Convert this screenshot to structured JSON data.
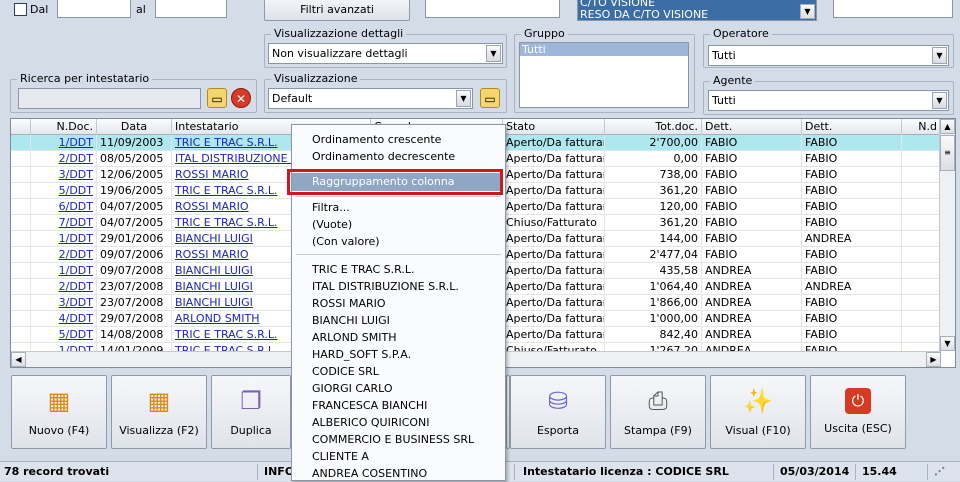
{
  "filters": {
    "dal_label": "Dal",
    "al_label": "al",
    "filtri_avanzati": "Filtri avanzati",
    "tipo_items": [
      "C/TO VISIONE",
      "RESO DA C/TO VISIONE"
    ],
    "ricerca_label": "Ricerca per intestatario",
    "ricerca_value": "",
    "dettagli_label": "Visualizzazione dettagli",
    "dettagli_value": "Non visualizzare dettagli",
    "visualizzazione_label": "Visualizzazione",
    "visualizzazione_value": "Default",
    "gruppo_label": "Gruppo",
    "gruppo_items": [
      "Tutti"
    ],
    "operatore_label": "Operatore",
    "operatore_value": "Tutti",
    "agente_label": "Agente",
    "agente_value": "Tutti"
  },
  "grid": {
    "columns": [
      "N.Doc.",
      "Data",
      "Intestatario",
      "Causale",
      "Stato",
      "Tot.doc.",
      "Dett.",
      "Dett.",
      "N.d"
    ],
    "rows": [
      {
        "ndoc": "1/DDT",
        "data": "11/09/2003",
        "intestatario": "TRIC E TRAC S.R.L.",
        "stato": "Aperto/Da fatturare",
        "tot": "2'700,00",
        "dett1": "FABIO",
        "dett2": "FABIO"
      },
      {
        "ndoc": "2/DDT",
        "data": "08/05/2005",
        "intestatario": "ITAL DISTRIBUZIONE S.R",
        "stato": "Aperto/Da fatturare",
        "tot": "0,00",
        "dett1": "FABIO",
        "dett2": "FABIO"
      },
      {
        "ndoc": "3/DDT",
        "data": "12/06/2005",
        "intestatario": "ROSSI MARIO",
        "stato": "Aperto/Da fatturare",
        "tot": "738,00",
        "dett1": "FABIO",
        "dett2": "FABIO"
      },
      {
        "ndoc": "5/DDT",
        "data": "19/06/2005",
        "intestatario": "TRIC E TRAC S.R.L.",
        "stato": "Aperto/Da fatturare",
        "tot": "361,20",
        "dett1": "FABIO",
        "dett2": "FABIO"
      },
      {
        "ndoc": "6/DDT",
        "data": "04/07/2005",
        "intestatario": "ROSSI MARIO",
        "stato": "Aperto/Da fatturare",
        "tot": "120,00",
        "dett1": "FABIO",
        "dett2": "FABIO"
      },
      {
        "ndoc": "7/DDT",
        "data": "04/07/2005",
        "intestatario": "TRIC E TRAC S.R.L.",
        "stato": "Chiuso/Fatturato",
        "tot": "361,20",
        "dett1": "FABIO",
        "dett2": "FABIO"
      },
      {
        "ndoc": "1/DDT",
        "data": "29/01/2006",
        "intestatario": "BIANCHI LUIGI",
        "stato": "Aperto/Da fatturare",
        "tot": "144,00",
        "dett1": "FABIO",
        "dett2": "ANDREA"
      },
      {
        "ndoc": "2/DDT",
        "data": "09/07/2006",
        "intestatario": "ROSSI MARIO",
        "stato": "Aperto/Da fatturare",
        "tot": "2'477,04",
        "dett1": "FABIO",
        "dett2": "FABIO"
      },
      {
        "ndoc": "1/DDT",
        "data": "09/07/2008",
        "intestatario": "BIANCHI LUIGI",
        "stato": "Aperto/Da fatturare",
        "tot": "435,58",
        "dett1": "ANDREA",
        "dett2": "FABIO"
      },
      {
        "ndoc": "2/DDT",
        "data": "23/07/2008",
        "intestatario": "BIANCHI LUIGI",
        "stato": "Aperto/Da fatturare",
        "tot": "1'064,40",
        "dett1": "ANDREA",
        "dett2": "ANDREA"
      },
      {
        "ndoc": "3/DDT",
        "data": "23/07/2008",
        "intestatario": "BIANCHI LUIGI",
        "stato": "Aperto/Da fatturare",
        "tot": "1'866,00",
        "dett1": "ANDREA",
        "dett2": "FABIO"
      },
      {
        "ndoc": "4/DDT",
        "data": "29/07/2008",
        "intestatario": "ARLOND SMITH",
        "stato": "Aperto/Da fatturare",
        "tot": "1'000,00",
        "dett1": "ANDREA",
        "dett2": "FABIO"
      },
      {
        "ndoc": "5/DDT",
        "data": "14/08/2008",
        "intestatario": "TRIC E TRAC S.R.L.",
        "stato": "Aperto/Da fatturare",
        "tot": "842,40",
        "dett1": "ANDREA",
        "dett2": "FABIO"
      },
      {
        "ndoc": "1/DDT",
        "data": "14/01/2009",
        "intestatario": "TRIC E TRAC S.R.L.",
        "stato": "Chiuso/Fatturato",
        "tot": "1'267,20",
        "dett1": "ANDREA",
        "dett2": "FABIO"
      }
    ]
  },
  "context_menu": {
    "sort_asc": "Ordinamento crescente",
    "sort_desc": "Ordinamento decrescente",
    "group_column": "Raggruppamento colonna",
    "filter": "Filtra...",
    "empty": "(Vuote)",
    "with_value": "(Con valore)",
    "values": [
      "TRIC E TRAC S.R.L.",
      "ITAL DISTRIBUZIONE S.R.L.",
      "ROSSI MARIO",
      "BIANCHI LUIGI",
      "ARLOND SMITH",
      "HARD_SOFT S.P.A.",
      "CODICE SRL",
      "GIORGI CARLO",
      "FRANCESCA BIANCHI",
      "ALBERICO QUIRICONI",
      "COMMERCIO E BUSINESS SRL",
      "CLIENTE A",
      "ANDREA COSENTINO"
    ]
  },
  "toolbar": {
    "nuovo": "Nuovo (F4)",
    "visualizza": "Visualizza (F2)",
    "duplica": "Duplica",
    "esporta": "Esporta",
    "stampa": "Stampa (F9)",
    "visual": "Visual (F10)",
    "uscita": "Uscita (ESC)"
  },
  "status": {
    "records": "78 record trovati",
    "info": "INFO",
    "licenza": "Intestatario licenza : CODICE SRL",
    "date": "05/03/2014",
    "time": "15.44"
  },
  "colors": {
    "highlight_row": "#aee7ee",
    "menu_highlight": "#8fa6c5",
    "red_box": "#d0181c",
    "link": "#1a24c8"
  }
}
